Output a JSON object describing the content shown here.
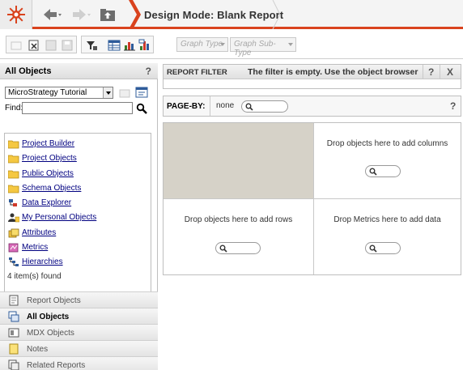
{
  "header": {
    "title": "Design Mode: Blank Report"
  },
  "toolbar": {
    "graph_type": "Graph Type",
    "graph_subtype": "Graph Sub-Type"
  },
  "left_panel": {
    "title": "All Objects",
    "help": "?",
    "project": "MicroStrategy Tutorial",
    "find_label": "Find:",
    "find_value": "",
    "items": [
      {
        "label": "Project Builder",
        "icon": "folder-icon"
      },
      {
        "label": "Project Objects",
        "icon": "folder-icon"
      },
      {
        "label": "Public Objects",
        "icon": "folder-icon"
      },
      {
        "label": "Schema Objects",
        "icon": "folder-icon"
      },
      {
        "label": "Data Explorer",
        "icon": "data-explorer-icon"
      },
      {
        "label": "My Personal Objects",
        "icon": "personal-objects-icon"
      },
      {
        "label": "Attributes",
        "icon": "attributes-icon"
      },
      {
        "label": "Metrics",
        "icon": "metrics-icon"
      },
      {
        "label": "Hierarchies",
        "icon": "hierarchies-icon"
      }
    ],
    "found": "4 item(s) found",
    "accordion": [
      {
        "label": "Report Objects",
        "icon": "report-objects-icon"
      },
      {
        "label": "All Objects",
        "icon": "all-objects-icon"
      },
      {
        "label": "MDX Objects",
        "icon": "mdx-objects-icon"
      },
      {
        "label": "Notes",
        "icon": "notes-icon"
      },
      {
        "label": "Related Reports",
        "icon": "related-reports-icon"
      }
    ]
  },
  "report_filter": {
    "title": "REPORT FILTER",
    "message": "The filter is empty. Use the object browser",
    "help": "?",
    "close": "X"
  },
  "page_by": {
    "label": "PAGE-BY:",
    "value": "none",
    "help": "?"
  },
  "grid": {
    "columns_hint": "Drop objects here to add columns",
    "rows_hint": "Drop objects here to add rows",
    "data_hint": "Drop Metrics here to add data"
  },
  "colors": {
    "accent": "#d9431e",
    "link": "#000080",
    "corner": "#d6d2c8"
  }
}
